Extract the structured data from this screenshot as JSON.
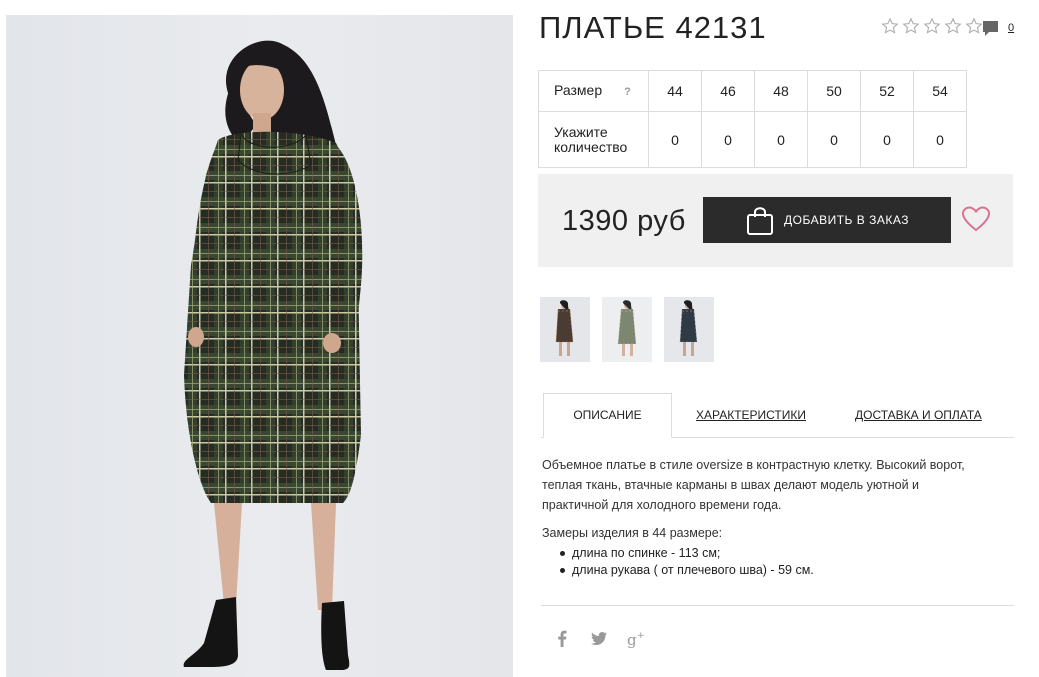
{
  "product": {
    "title": "ПЛАТЬЕ 42131",
    "rating_stars": 5,
    "comments_count": "0"
  },
  "sizes": {
    "size_label": "Размер",
    "help_mark": "?",
    "values": [
      "44",
      "46",
      "48",
      "50",
      "52",
      "54"
    ],
    "qty_label_line1": "Укажите",
    "qty_label_line2": "количество",
    "quantities": [
      "0",
      "0",
      "0",
      "0",
      "0",
      "0"
    ]
  },
  "purchase": {
    "price": "1390 руб",
    "add_button": "ДОБАВИТЬ В ЗАКАЗ"
  },
  "tabs": {
    "description": "ОПИСАНИЕ",
    "characteristics": "ХАРАКТЕРИСТИКИ",
    "delivery": "ДОСТАВКА И ОПЛАТА"
  },
  "description": {
    "line1": "Объемное платье в стиле oversize в контрастную клетку. Высокий ворот,",
    "line2": "теплая ткань, втачные карманы в швах делают модель уютной и",
    "line3": "практичной для холодного времени года.",
    "measure_title": "Замеры изделия в 44 размере:",
    "bullets": [
      "длина по спинке - 113 см;",
      "длина рукава ( от плечевого шва) - 59 см."
    ]
  },
  "social": {
    "facebook": "f",
    "googleplus": "g+"
  },
  "colors": {
    "dark_button": "#2b2b2b",
    "price_bg": "#f0f0f0",
    "heart": "#d9738f",
    "dress_base": "#2a3327",
    "plaid_line": "#c9c59a"
  }
}
